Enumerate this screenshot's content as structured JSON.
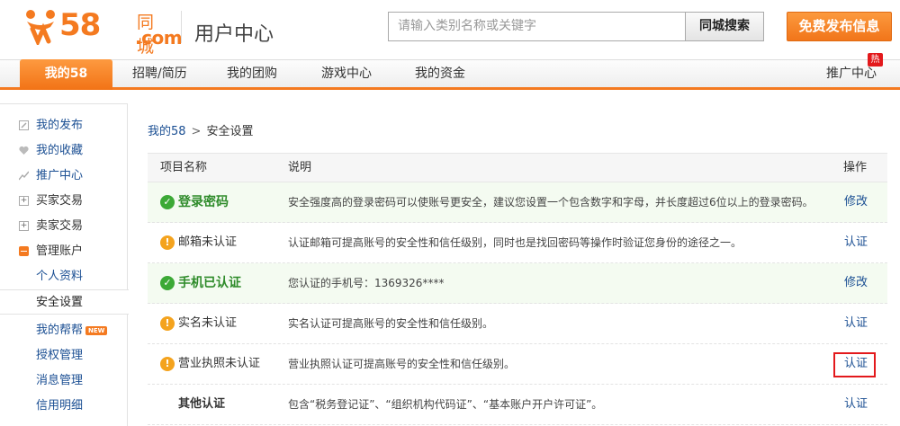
{
  "header": {
    "logo_number": "58",
    "logo_cn": "同城",
    "logo_domain": ".com",
    "page_title": "用户中心",
    "search_placeholder": "请输入类别名称或关键字",
    "search_button": "同城搜索",
    "post_button": "免费发布信息"
  },
  "nav": {
    "active": "我的58",
    "items": [
      "招聘/简历",
      "我的团购",
      "游戏中心",
      "我的资金"
    ],
    "promo": "推广中心",
    "hot_badge": "热"
  },
  "sidebar": {
    "items": [
      {
        "label": "我的发布",
        "icon": "edit-icon"
      },
      {
        "label": "我的收藏",
        "icon": "heart-icon"
      },
      {
        "label": "推广中心",
        "icon": "chart-icon"
      },
      {
        "label": "买家交易",
        "icon": "plus-icon"
      },
      {
        "label": "卖家交易",
        "icon": "plus-icon"
      },
      {
        "label": "管理账户",
        "icon": "minus-icon"
      },
      {
        "label": "个人资料"
      },
      {
        "label": "安全设置"
      },
      {
        "label": "我的帮帮",
        "badge": "NEW"
      },
      {
        "label": "授权管理"
      },
      {
        "label": "消息管理"
      },
      {
        "label": "信用明细"
      }
    ]
  },
  "breadcrumb": {
    "root": "我的58",
    "separator": ">",
    "current": "安全设置"
  },
  "table": {
    "headers": {
      "name": "项目名称",
      "desc": "说明",
      "action": "操作"
    },
    "rows": [
      {
        "name": "登录密码",
        "status": "ok",
        "desc": "安全强度高的登录密码可以使账号更安全，建议您设置一个包含数字和字母，并长度超过6位以上的登录密码。",
        "action": "修改"
      },
      {
        "name": "邮箱未认证",
        "status": "warn",
        "desc": "认证邮箱可提高账号的安全性和信任级别，同时也是找回密码等操作时验证您身份的途径之一。",
        "action": "认证"
      },
      {
        "name": "手机已认证",
        "status": "ok",
        "desc": "您认证的手机号：1369326****",
        "action": "修改"
      },
      {
        "name": "实名未认证",
        "status": "warn",
        "desc": "实名认证可提高账号的安全性和信任级别。",
        "action": "认证"
      },
      {
        "name": "营业执照未认证",
        "status": "warn",
        "desc": "营业执照认证可提高账号的安全性和信任级别。",
        "action": "认证"
      },
      {
        "name": "其他认证",
        "status": "none",
        "desc": "包含“税务登记证”、“组织机构代码证”、“基本账户开户许可证”。",
        "action": "认证"
      }
    ]
  },
  "colors": {
    "brand_orange": "#f47a20",
    "ok_green": "#3ca936",
    "warn_orange": "#f4a31e",
    "link_blue": "#1b4f93",
    "highlight_red": "#e3191c"
  }
}
